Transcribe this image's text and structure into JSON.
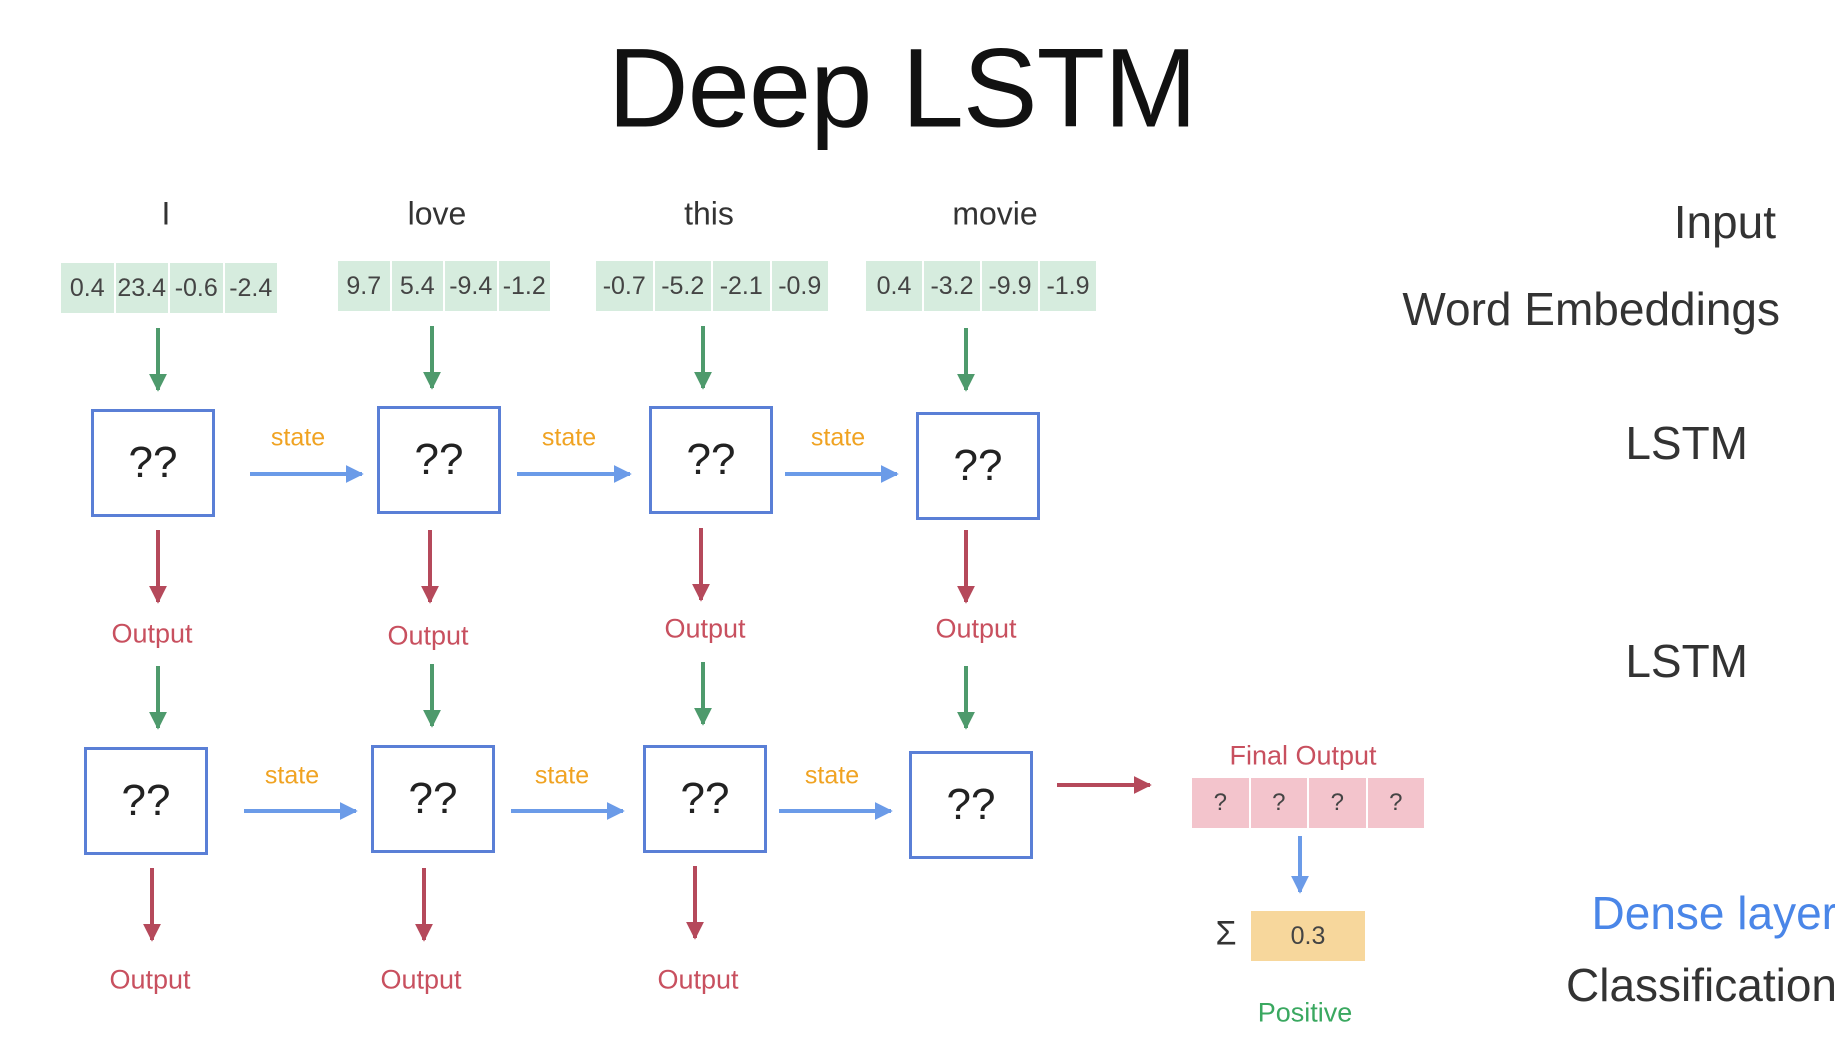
{
  "title": "Deep LSTM",
  "words": [
    "I",
    "love",
    "this",
    "movie"
  ],
  "embeddings": [
    [
      "0.4",
      "23.4",
      "-0.6",
      "-2.4"
    ],
    [
      "9.7",
      "5.4",
      "-9.4",
      "-1.2"
    ],
    [
      "-0.7",
      "-5.2",
      "-2.1",
      "-0.9"
    ],
    [
      "0.4",
      "-3.2",
      "-9.9",
      "-1.9"
    ]
  ],
  "cell_label": "??",
  "state_label": "state",
  "output_label": "Output",
  "final_output": {
    "label": "Final Output",
    "values": [
      "?",
      "?",
      "?",
      "?"
    ]
  },
  "sigma": "Σ",
  "score": "0.3",
  "prediction": "Positive",
  "side_labels": {
    "input": "Input",
    "embeddings": "Word Embeddings",
    "lstm1": "LSTM",
    "lstm2": "LSTM",
    "dense": "Dense layer",
    "classification": "Classification"
  },
  "colors": {
    "cell_border": "#5a7fd6",
    "state_arrow": "#6b9be8",
    "state_text": "#f0a322",
    "input_arrow": "#4e9a6c",
    "output_arrow": "#b5495b",
    "output_text": "#c8505f",
    "embedding_fill": "#d6ecde",
    "final_fill": "#f3c4cc",
    "score_fill": "#f7d79c",
    "positive_text": "#3aa860",
    "dense_text": "#4a86e8"
  }
}
